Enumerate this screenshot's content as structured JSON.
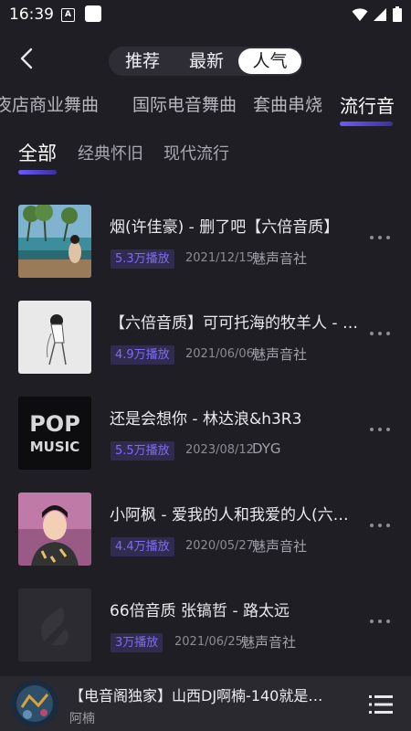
{
  "status_bar": {
    "time": "16:39",
    "badge": "A"
  },
  "header": {
    "back_icon": "chevron-left-icon",
    "segments": [
      "推荐",
      "最新",
      "人气"
    ],
    "selected_segment": "人气"
  },
  "categories": {
    "items": [
      "夜店商业舞曲",
      "国际电音舞曲",
      "套曲串烧",
      "流行音"
    ],
    "active": "流行音"
  },
  "subcategories": {
    "items": [
      "全部",
      "经典怀旧",
      "现代流行"
    ],
    "active": "全部"
  },
  "songs": [
    {
      "title": "烟(许佳豪) - 删了吧【六倍音质】",
      "plays": "5.3万播放",
      "date": "2021/12/15",
      "artist": "魅声音社"
    },
    {
      "title": "【六倍音质】可可托海的牧羊人 - …",
      "plays": "4.9万播放",
      "date": "2021/06/06",
      "artist": "魅声音社"
    },
    {
      "title": "还是会想你 - 林达浪&h3R3",
      "plays": "5.5万播放",
      "date": "2023/08/12",
      "artist": "DYG",
      "cover_text": [
        "POP",
        "MUSIC"
      ]
    },
    {
      "title": "小阿枫 - 爱我的人和我爱的人(六…",
      "plays": "4.4万播放",
      "date": "2020/05/27",
      "artist": "魅声音社"
    },
    {
      "title": "66倍音质 张镐哲 - 路太远",
      "plays": "3万播放",
      "date": "2021/06/25",
      "artist": "魅声音社"
    }
  ],
  "player": {
    "title": "【电音阁独家】山西DJ啊楠-140就是…",
    "artist": "阿楠",
    "playlist_icon": "playlist-icon"
  },
  "colors": {
    "background": "#1f1e24",
    "accent": "#6c5bf7",
    "play_badge_bg": "#302b4f",
    "play_badge_text": "#7d6cf2"
  }
}
